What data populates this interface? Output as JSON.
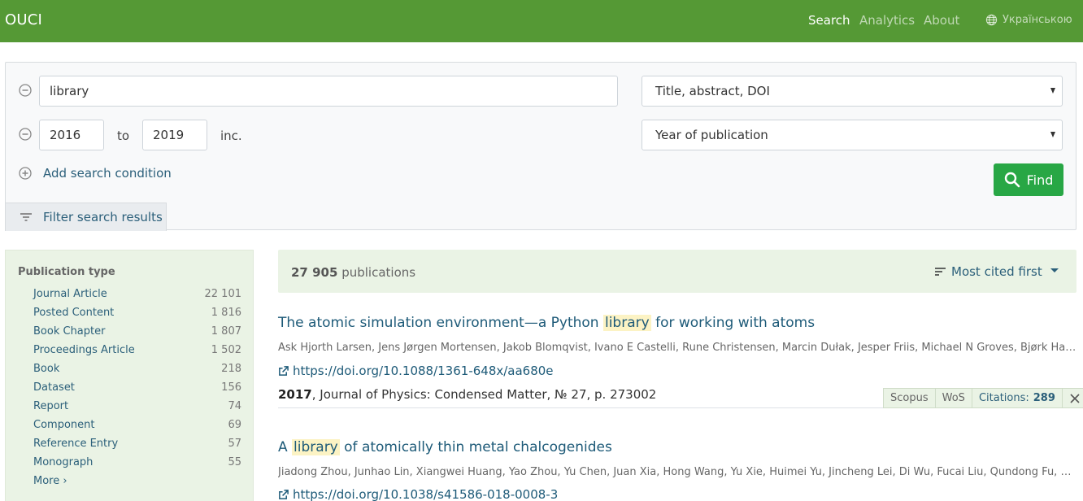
{
  "navbar": {
    "brand": "OUCI",
    "links": [
      "Search",
      "Analytics",
      "About"
    ],
    "language": "Українською"
  },
  "search": {
    "query": "library",
    "query_field": "Title, abstract, DOI",
    "year_from": "2016",
    "year_to": "2019",
    "to_label": "to",
    "inc_label": "inc.",
    "year_field": "Year of publication",
    "add_condition": "Add search condition",
    "find_label": "Find",
    "filter_label": "Filter search results"
  },
  "sidebar": {
    "heading": "Publication type",
    "items": [
      {
        "label": "Journal Article",
        "count": "22 101"
      },
      {
        "label": "Posted Content",
        "count": "1 816"
      },
      {
        "label": "Book Chapter",
        "count": "1 807"
      },
      {
        "label": "Proceedings Article",
        "count": "1 502"
      },
      {
        "label": "Book",
        "count": "218"
      },
      {
        "label": "Dataset",
        "count": "156"
      },
      {
        "label": "Report",
        "count": "74"
      },
      {
        "label": "Component",
        "count": "69"
      },
      {
        "label": "Reference Entry",
        "count": "57"
      },
      {
        "label": "Monograph",
        "count": "55"
      }
    ],
    "more": "More ›"
  },
  "results": {
    "count": "27 905",
    "count_label": "publications",
    "sort_label": "Most cited first",
    "items": [
      {
        "title_before": "The atomic simulation environment—a Python ",
        "title_highlight": "library",
        "title_after": " for working with atoms",
        "authors": "Ask Hjorth Larsen, Jens Jørgen Mortensen, Jakob Blomqvist, Ivano E Castelli, Rune Christensen, Marcin Dułak, Jesper Friis, Michael N Groves, Bjørk Hammer, Cristopher Hargus",
        "doi": "https://doi.org/10.1088/1361-648x/aa680e",
        "year": "2017",
        "source": ", Journal of Physics: Condensed Matter, № 27, p. 273002",
        "scopus": "Scopus",
        "wos": "WoS",
        "citations_label": "Citations:",
        "citations": "289"
      },
      {
        "title_before": "A ",
        "title_highlight": "library",
        "title_after": " of atomically thin metal chalcogenides",
        "authors": "Jiadong Zhou, Junhao Lin, Xiangwei Huang, Yao Zhou, Yu Chen, Juan Xia, Hong Wang, Yu Xie, Huimei Yu, Jincheng Lei, Di Wu, Fucai Liu, Qundong Fu, Qingsheng Zeng",
        "doi": "https://doi.org/10.1038/s41586-018-0008-3"
      }
    ]
  }
}
